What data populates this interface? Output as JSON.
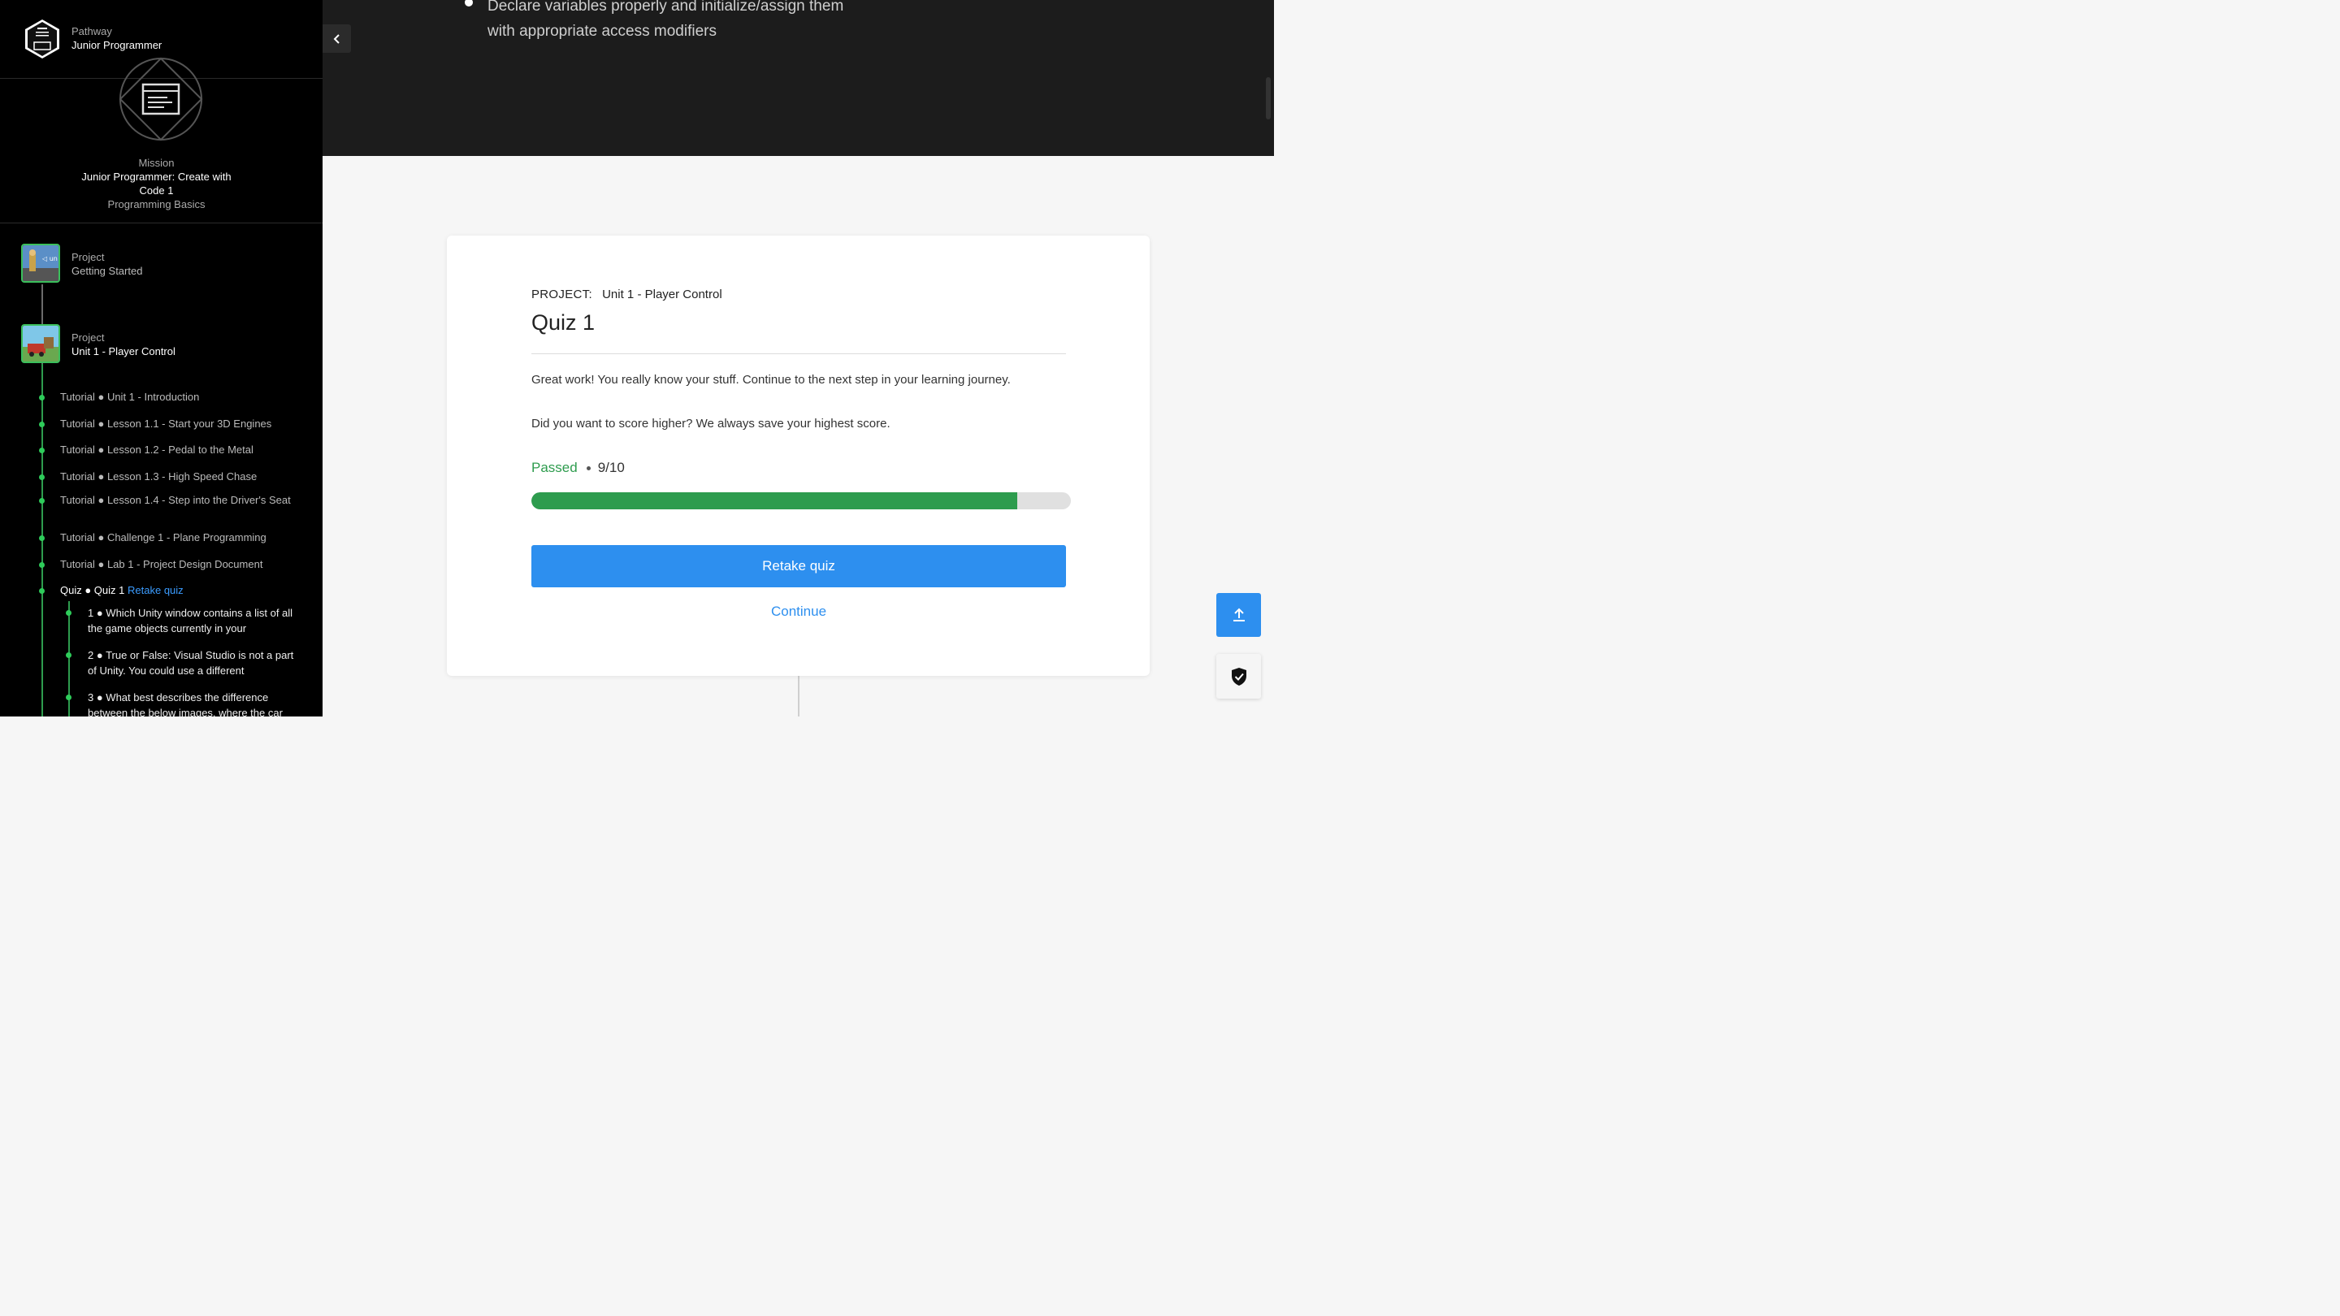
{
  "sidebar": {
    "pathway": {
      "label": "Pathway",
      "name": "Junior Programmer"
    },
    "mission": {
      "label": "Mission",
      "name": "Junior Programmer: Create with Code 1",
      "subtitle": "Programming Basics"
    },
    "projects": [
      {
        "label": "Project",
        "name": "Getting Started"
      },
      {
        "label": "Project",
        "name": "Unit 1 - Player Control"
      }
    ],
    "steps": [
      "Tutorial ● Unit 1 - Introduction",
      "Tutorial ● Lesson 1.1 - Start your 3D Engines",
      "Tutorial ● Lesson 1.2 - Pedal to the Metal",
      "Tutorial ● Lesson 1.3 - High Speed Chase",
      "Tutorial ● Lesson 1.4 - Step into the Driver's Seat",
      "Tutorial ● Challenge 1 - Plane Programming",
      "Tutorial ● Lab 1 - Project Design Document"
    ],
    "active_step": {
      "text": "Quiz ● Quiz 1",
      "retake_label": "Retake quiz"
    },
    "questions": [
      "1 ● Which Unity window contains a list of all the game objects currently in your",
      "2 ● True or False: Visual Studio is not a part of Unity. You could use a different",
      "3 ● What best describes the difference between the below images, where the car"
    ]
  },
  "objective": {
    "text": "Declare variables properly and initialize/assign them with appropriate access modifiers"
  },
  "quiz": {
    "project_label": "PROJECT:",
    "project_name": "Unit 1 - Player Control",
    "title": "Quiz 1",
    "message1": "Great work! You really know your stuff. Continue to the next step in your learning journey.",
    "message2": "Did you want to score higher? We always save your highest score.",
    "status": "Passed",
    "score": "9/10",
    "progress_fraction": 0.9,
    "retake_button": "Retake quiz",
    "continue_button": "Continue"
  },
  "colors": {
    "accent": "#2d8fef",
    "success": "#2e9c4e"
  },
  "icons": {
    "collapse": "chevron-left-icon",
    "upload": "upload-arrow-icon",
    "privacy": "shield-check-icon"
  }
}
